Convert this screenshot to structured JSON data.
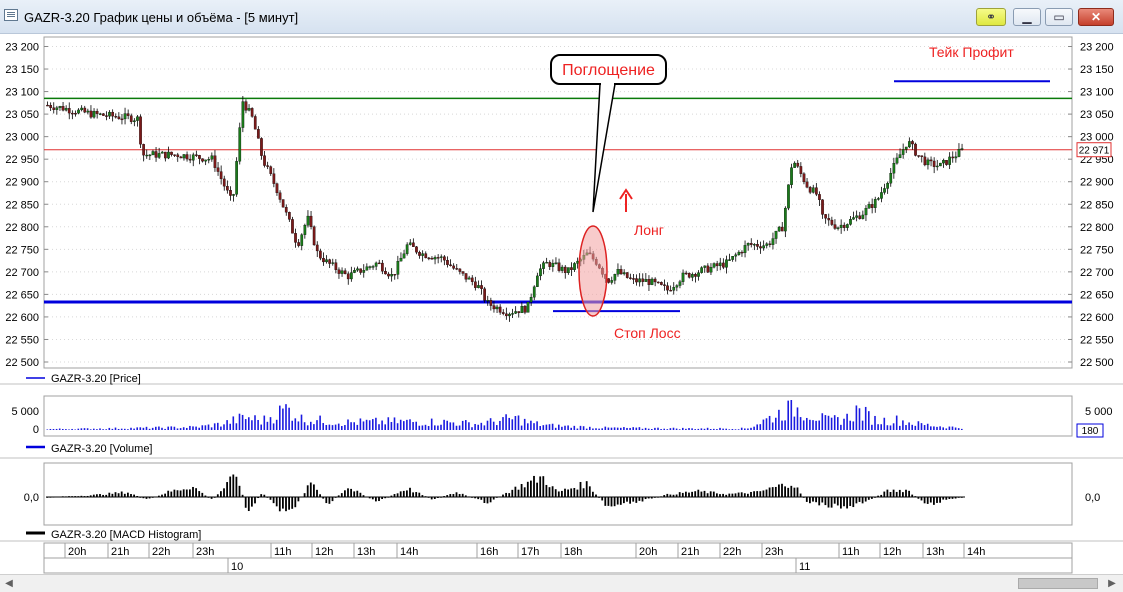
{
  "window": {
    "title": "GAZR-3.20 График цены и объёма - [5 минут]"
  },
  "price_panel": {
    "legend": "GAZR-3.20 [Price]",
    "current_price_label": "22 971",
    "y_ticks": [
      "23 200",
      "23 150",
      "23 100",
      "23 050",
      "23 000",
      "22 950",
      "22 900",
      "22 850",
      "22 800",
      "22 750",
      "22 700",
      "22 650",
      "22 600",
      "22 550",
      "22 500"
    ],
    "annotations": {
      "callout": "Поглощение",
      "long": "Лонг",
      "stop_loss": "Стоп Лосс",
      "take_profit": "Тейк Профит"
    }
  },
  "volume_panel": {
    "legend": "GAZR-3.20 [Volume]",
    "y_ticks": [
      "5 000",
      "0"
    ],
    "current_volume_label": "180"
  },
  "macd_panel": {
    "legend": "GAZR-3.20 [MACD Histogram]",
    "y_tick": "0,0"
  },
  "time_axis": {
    "hours": [
      "20h",
      "21h",
      "22h",
      "23h",
      "11h",
      "12h",
      "13h",
      "14h",
      "16h",
      "17h",
      "18h",
      "20h",
      "21h",
      "22h",
      "23h",
      "11h",
      "12h",
      "13h",
      "14h"
    ],
    "dates": [
      "10",
      "11"
    ]
  },
  "colors": {
    "up_candle": "#1a7a1a",
    "down_candle": "#7a1a1a",
    "volume_bar": "#1a1ae0",
    "blue_line": "#0000dd",
    "green_level": "#0a7a0a",
    "red_level": "#e03030",
    "annotation_red": "#ee2222"
  },
  "chart_data": {
    "type": "candlestick",
    "ylim": [
      22500,
      23200
    ],
    "levels": {
      "resistance_green": 23085,
      "current_price_red": 22971,
      "support_blue": 22633,
      "stop_loss": 22613,
      "take_profit": 23123
    },
    "price_path": [
      [
        0,
        23070
      ],
      [
        45,
        23050
      ],
      [
        90,
        23040
      ],
      [
        95,
        22960
      ],
      [
        130,
        22960
      ],
      [
        165,
        22950
      ],
      [
        185,
        22850
      ],
      [
        195,
        23080
      ],
      [
        205,
        23040
      ],
      [
        215,
        22950
      ],
      [
        230,
        22880
      ],
      [
        250,
        22760
      ],
      [
        260,
        22820
      ],
      [
        270,
        22740
      ],
      [
        280,
        22720
      ],
      [
        300,
        22690
      ],
      [
        330,
        22720
      ],
      [
        345,
        22690
      ],
      [
        360,
        22760
      ],
      [
        375,
        22740
      ],
      [
        395,
        22730
      ],
      [
        410,
        22700
      ],
      [
        430,
        22670
      ],
      [
        440,
        22630
      ],
      [
        460,
        22610
      ],
      [
        480,
        22620
      ],
      [
        490,
        22700
      ],
      [
        500,
        22720
      ],
      [
        520,
        22700
      ],
      [
        540,
        22740
      ],
      [
        550,
        22720
      ],
      [
        560,
        22680
      ],
      [
        570,
        22700
      ],
      [
        585,
        22680
      ],
      [
        600,
        22680
      ],
      [
        620,
        22660
      ],
      [
        635,
        22690
      ],
      [
        650,
        22700
      ],
      [
        680,
        22720
      ],
      [
        700,
        22760
      ],
      [
        720,
        22760
      ],
      [
        735,
        22800
      ],
      [
        745,
        22950
      ],
      [
        760,
        22890
      ],
      [
        770,
        22870
      ],
      [
        775,
        22820
      ],
      [
        790,
        22800
      ],
      [
        800,
        22810
      ],
      [
        815,
        22830
      ],
      [
        830,
        22860
      ],
      [
        850,
        22950
      ],
      [
        860,
        22990
      ],
      [
        870,
        22960
      ],
      [
        880,
        22940
      ],
      [
        893,
        22935
      ],
      [
        905,
        22955
      ],
      [
        915,
        22970
      ]
    ],
    "volume_spikes": [
      [
        0,
        300
      ],
      [
        60,
        500
      ],
      [
        120,
        800
      ],
      [
        150,
        1000
      ],
      [
        175,
        2000
      ],
      [
        190,
        3500
      ],
      [
        200,
        4200
      ],
      [
        215,
        3000
      ],
      [
        240,
        7200
      ],
      [
        255,
        3500
      ],
      [
        270,
        3200
      ],
      [
        300,
        2500
      ],
      [
        350,
        2800
      ],
      [
        400,
        2600
      ],
      [
        430,
        2000
      ],
      [
        460,
        3500
      ],
      [
        470,
        3800
      ],
      [
        480,
        2500
      ],
      [
        500,
        1500
      ],
      [
        520,
        1200
      ],
      [
        560,
        700
      ],
      [
        600,
        600
      ],
      [
        640,
        500
      ],
      [
        700,
        500
      ],
      [
        745,
        7500
      ],
      [
        750,
        7000
      ],
      [
        760,
        6000
      ],
      [
        780,
        3000
      ],
      [
        800,
        4000
      ],
      [
        810,
        6500
      ],
      [
        830,
        3000
      ],
      [
        850,
        3300
      ],
      [
        870,
        2000
      ],
      [
        900,
        1000
      ],
      [
        915,
        800
      ]
    ],
    "macd_wave": [
      [
        0,
        0
      ],
      [
        40,
        3
      ],
      [
        80,
        10
      ],
      [
        100,
        -6
      ],
      [
        120,
        10
      ],
      [
        145,
        22
      ],
      [
        165,
        -6
      ],
      [
        190,
        48
      ],
      [
        200,
        -36
      ],
      [
        215,
        10
      ],
      [
        240,
        -40
      ],
      [
        265,
        32
      ],
      [
        280,
        -18
      ],
      [
        300,
        20
      ],
      [
        330,
        -10
      ],
      [
        360,
        18
      ],
      [
        385,
        -5
      ],
      [
        410,
        10
      ],
      [
        440,
        -12
      ],
      [
        470,
        20
      ],
      [
        495,
        42
      ],
      [
        510,
        10
      ],
      [
        540,
        28
      ],
      [
        560,
        -22
      ],
      [
        590,
        -10
      ],
      [
        620,
        5
      ],
      [
        650,
        12
      ],
      [
        680,
        6
      ],
      [
        710,
        10
      ],
      [
        745,
        30
      ],
      [
        760,
        -10
      ],
      [
        780,
        -18
      ],
      [
        800,
        -22
      ],
      [
        820,
        -8
      ],
      [
        840,
        12
      ],
      [
        860,
        15
      ],
      [
        880,
        -18
      ],
      [
        895,
        -8
      ],
      [
        915,
        0
      ]
    ]
  }
}
